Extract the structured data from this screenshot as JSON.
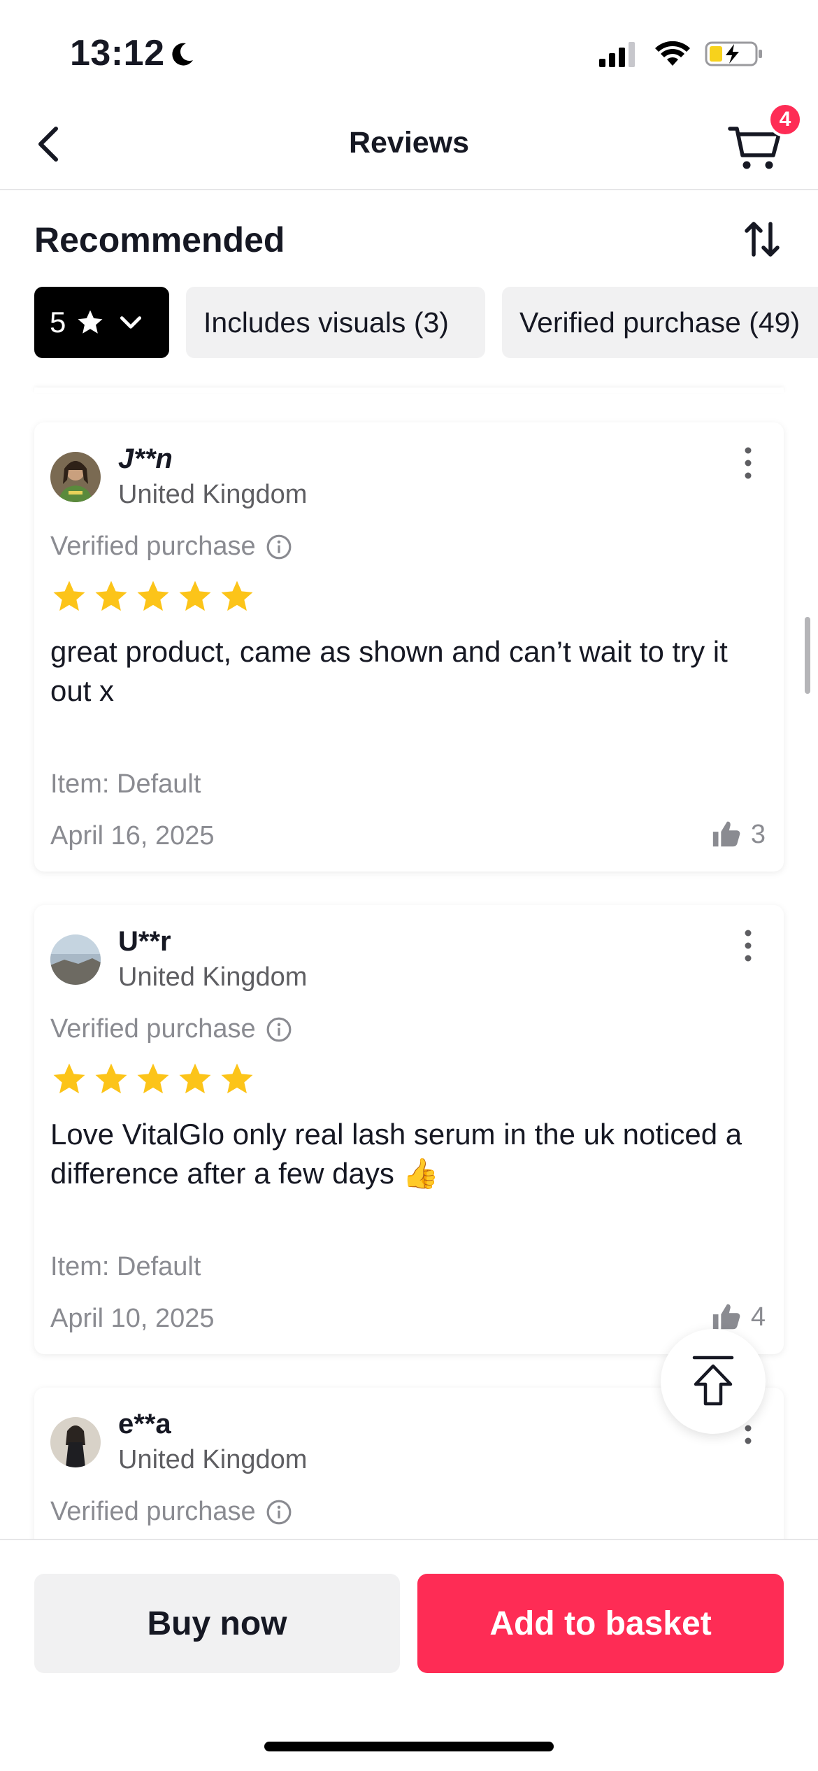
{
  "status_bar": {
    "time": "13:12"
  },
  "nav": {
    "title": "Reviews",
    "cart_count": "4"
  },
  "sort": {
    "label": "Recommended"
  },
  "filters": {
    "rating": "5",
    "visuals": "Includes visuals (3)",
    "verified": "Verified purchase (49)"
  },
  "reviews": [
    {
      "name": "J**n",
      "location": "United Kingdom",
      "verified": "Verified purchase",
      "rating": 5,
      "text": "great product, came as shown and can’t wait to try it out x",
      "item": "Item: Default",
      "date": "April 16, 2025",
      "likes": "3"
    },
    {
      "name": "U**r",
      "location": "United Kingdom",
      "verified": "Verified purchase",
      "rating": 5,
      "text": "Love VitalGlo only real lash serum in the uk noticed a difference after a few days 👍",
      "item": "Item: Default",
      "date": "April 10, 2025",
      "likes": "4"
    },
    {
      "name": "e**a",
      "location": "United Kingdom",
      "verified": "Verified purchase"
    }
  ],
  "actions": {
    "buy_now": "Buy now",
    "add_to_basket": "Add to basket"
  },
  "colors": {
    "accent": "#fe2c55",
    "star": "#fcc419",
    "chip_active": "#000000"
  }
}
